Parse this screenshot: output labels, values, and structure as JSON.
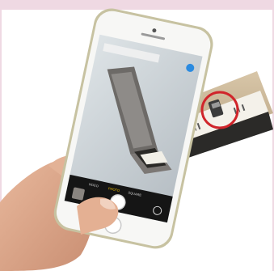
{
  "photo": {
    "phone": {
      "camera_modes": [
        "VIDEO",
        "PHOTO",
        "SQUARE"
      ],
      "caption_bar": "",
      "thumbnail": "gallery-thumbnail"
    },
    "label_strip_text": "",
    "highlight": {
      "color": "#d0252b",
      "shape": "circle"
    },
    "frame_color": "#efd9e3"
  }
}
